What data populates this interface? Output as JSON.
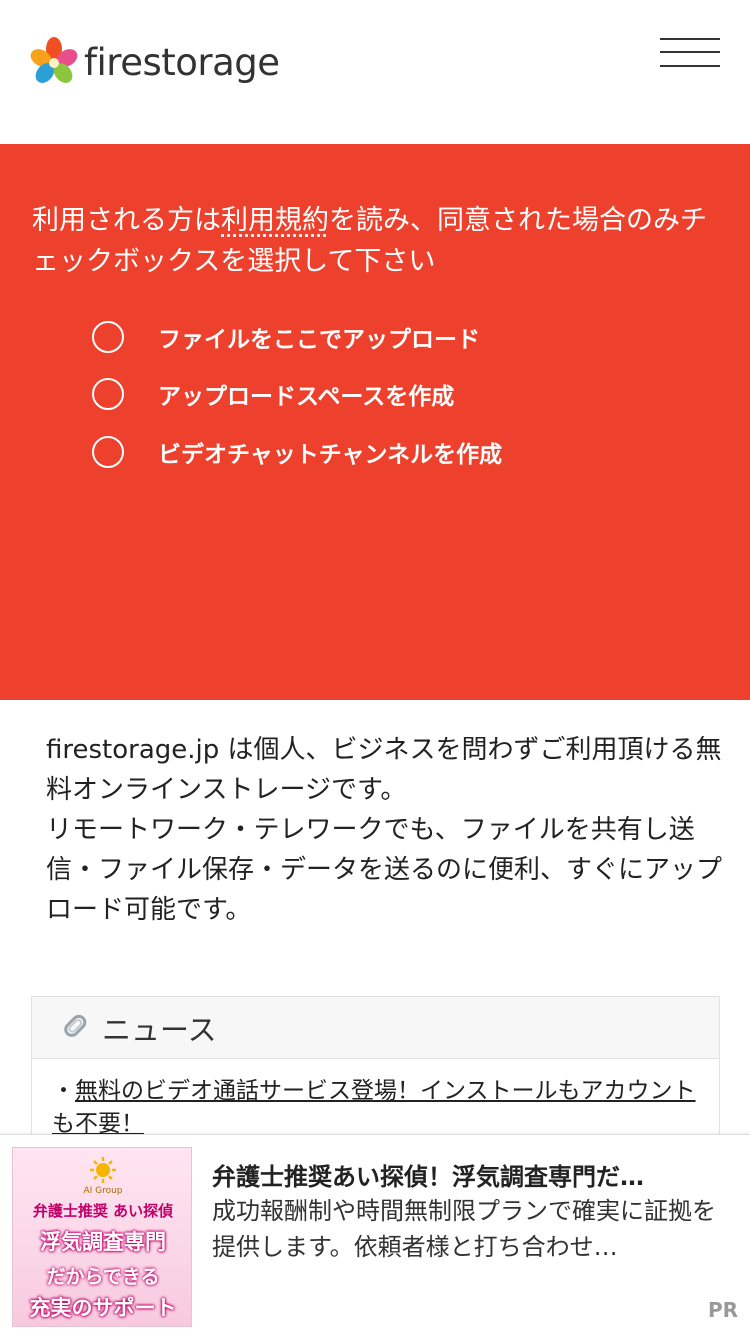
{
  "header": {
    "logo_text": "firestorage",
    "menu_icon": "hamburger-menu-icon"
  },
  "hero": {
    "bg_color": "#ee412d",
    "intro_before": "利用される方は",
    "terms_link": "利用規約",
    "intro_after": "を読み、同意された場合のみチェックボックスを選択して下さい",
    "options": [
      "ファイルをここでアップロード",
      "アップロードスペースを作成",
      "ビデオチャットチャンネルを作成"
    ]
  },
  "description": "firestorage.jp は個人、ビジネスを問わずご利用頂ける無料オンラインストレージです。\nリモートワーク・テレワークでも、ファイルを共有し送信・ファイル保存・データを送るのに便利、すぐにアップロード可能です。",
  "news": {
    "title": "ニュース",
    "icon": "paperclip-icon",
    "items": [
      {
        "bullet": "・",
        "text": "無料のビデオ通話サービス登場！インストールもアカウントも不要！"
      }
    ]
  },
  "ad": {
    "image": {
      "brand": "AI Group",
      "line1": "弁護士推奨 あい探偵",
      "line2": "浮気調査専門",
      "line3": "だからできる",
      "line4": "充実のサポート"
    },
    "title": "弁護士推奨あい探偵！浮気調査専門だ…",
    "body": "成功報酬制や時間無制限プランで確実に証拠を提供します。依頼者様と打ち合わせ…",
    "pr_label": "PR"
  }
}
